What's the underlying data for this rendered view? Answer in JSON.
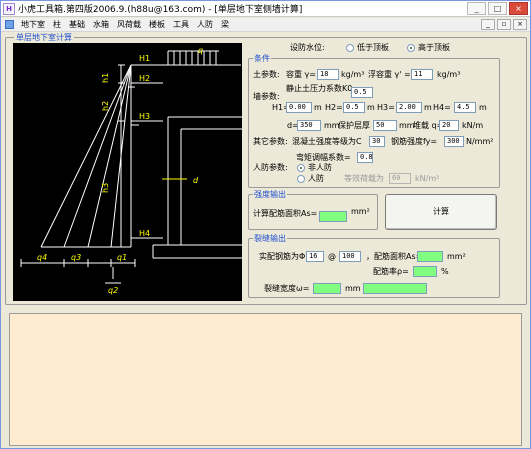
{
  "window": {
    "title": "小虎工具箱.第四版2006.9.(h88u@163.com) - [单层地下室侧墙计算]",
    "app_icon_text": "H",
    "controls": {
      "minimize": "_",
      "maximize": "□",
      "close": "×"
    }
  },
  "menu": {
    "items": [
      "地下室",
      "柱",
      "基础",
      "水箱",
      "风荷载",
      "楼板",
      "工具",
      "人防",
      "梁"
    ],
    "mdi_controls": {
      "minimize": "_",
      "restore": "▫",
      "close": "×"
    }
  },
  "main_group": {
    "caption": "单层地下室计算"
  },
  "drawing": {
    "labels": {
      "q": "q",
      "H1": "H1",
      "h1": "h1",
      "H2": "H2",
      "h2": "h2",
      "H3": "H3",
      "h3": "h3",
      "H4": "H4",
      "d": "d",
      "q4": "q4",
      "q3": "q3",
      "q1": "q1",
      "q2": "q2"
    }
  },
  "water_level": {
    "label": "设防水位:",
    "options": [
      {
        "label": "低于顶板",
        "selected": false
      },
      {
        "label": "高于顶板",
        "selected": true
      }
    ]
  },
  "conditions": {
    "caption": "条件",
    "soil_params_label": "土参数:",
    "unit_weight_label": "容重 γ=",
    "unit_weight_value": "18",
    "unit_weight_unit": "kg/m³",
    "buoyant_label": "浮容重 γ' =",
    "buoyant_value": "11",
    "buoyant_unit": "kg/m³",
    "wall_params_label": "墙参数:",
    "static_k_label": "静止土压力系数K0",
    "static_k_value": "0.5",
    "H1_label": "H1=",
    "H1_value": "0.00",
    "H1_unit": "m",
    "H2_label": "H2=",
    "H2_value": "0.5",
    "H2_unit": "m",
    "H3_label": "H3=",
    "H3_value": "2.00",
    "H3_unit": "m",
    "H4_label": "H4=",
    "H4_value": "4.5",
    "H4_unit": "m",
    "d_label": "d=",
    "d_value": "350",
    "d_unit": "mm",
    "cover_label": "保护层厚",
    "cover_value": "50",
    "cover_unit": "mm",
    "surcharge_label": "堆载 q=",
    "surcharge_value": "20",
    "surcharge_unit": "kN/m",
    "other_params_label": "其它参数:",
    "concrete_label": "混凝土强度等级为C",
    "concrete_value": "30",
    "steel_label": "钢筋强度fy=",
    "steel_value": "300",
    "steel_unit": "N/mm²",
    "moment_factor_label": "弯矩调幅系数=",
    "moment_factor_value": "0.8",
    "civil_defense_label": "人防参数:",
    "defense_options": [
      {
        "label": "非人防",
        "selected": true
      },
      {
        "label": "人防",
        "selected": false
      }
    ],
    "equiv_load_label": "等效荷载为",
    "equiv_load_value": "60",
    "equiv_load_unit": "kN/m²"
  },
  "strength_output": {
    "caption": "强度输出",
    "area_label": "计算配筋面积As=",
    "area_value": "",
    "area_unit": "mm²"
  },
  "calc_button": {
    "label": "计算"
  },
  "crack_output": {
    "caption": "裂缝输出",
    "rebar_label": "实配钢筋为Φ",
    "rebar_dia": "16",
    "at_symbol": "@",
    "rebar_spacing": "100",
    "rebar_area_label": "，配筋面积As=",
    "rebar_area_value": "",
    "rebar_area_unit": "mm²",
    "ratio_label": "配筋率ρ=",
    "ratio_value": "",
    "ratio_unit": "%",
    "crack_width_label": "裂缝宽度ω=",
    "crack_width_value": "",
    "crack_width_unit": "mm",
    "crack_result": ""
  },
  "output_area": {
    "text": ""
  }
}
